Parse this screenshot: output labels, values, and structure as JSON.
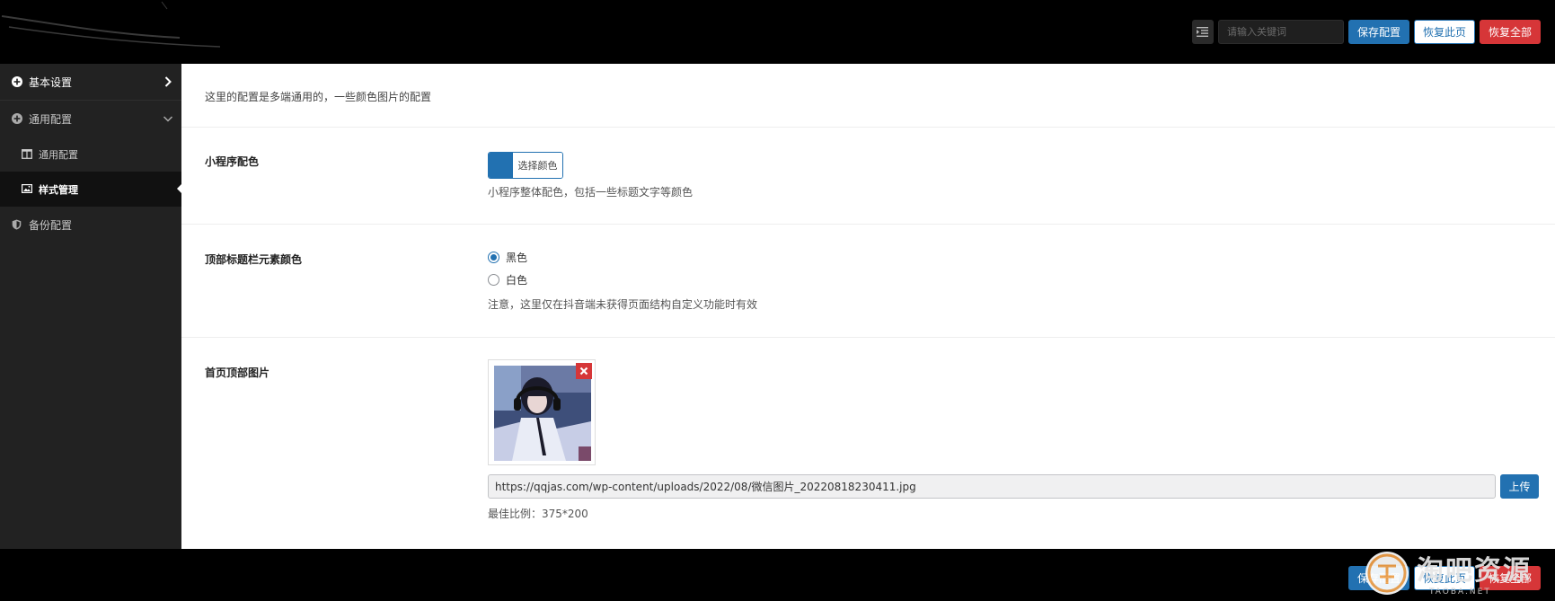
{
  "header": {
    "search_placeholder": "请输入关键词",
    "save_label": "保存配置",
    "restore_page_label": "恢复此页",
    "restore_all_label": "恢复全部"
  },
  "sidebar": {
    "items": [
      {
        "label": "基本设置",
        "icon": "plus-circle-icon",
        "state": "collapsed"
      },
      {
        "label": "通用配置",
        "icon": "plus-circle-icon",
        "state": "expanded",
        "children": [
          {
            "label": "通用配置",
            "icon": "columns-icon",
            "active": false
          },
          {
            "label": "样式管理",
            "icon": "image-icon",
            "active": true
          }
        ]
      },
      {
        "label": "备份配置",
        "icon": "shield-icon"
      }
    ]
  },
  "main": {
    "intro": "这里的配置是多端通用的，一些颜色图片的配置",
    "fields": {
      "color": {
        "label": "小程序配色",
        "button_label": "选择颜色",
        "color_value": "#2271b1",
        "desc": "小程序整体配色，包括一些标题文字等颜色"
      },
      "titlebar": {
        "label": "顶部标题栏元素颜色",
        "options": [
          "黑色",
          "白色"
        ],
        "selected": "黑色",
        "note": "注意，这里仅在抖音端未获得页面结构自定义功能时有效"
      },
      "banner": {
        "label": "首页顶部图片",
        "url": "https://qqjas.com/wp-content/uploads/2022/08/微信图片_20220818230411.jpg",
        "upload_label": "上传",
        "ratio_note": "最佳比例：375*200"
      }
    }
  },
  "footer": {
    "save_label": "保存配置",
    "restore_page_label": "恢复此页",
    "restore_all_label": "恢复全部",
    "watermark_text": "淘吧资源",
    "watermark_sub": "TAOBA.NET"
  },
  "colors": {
    "primary": "#2271b1",
    "danger": "#d63638",
    "sidebar_bg": "#222222",
    "header_bg": "#000000"
  }
}
